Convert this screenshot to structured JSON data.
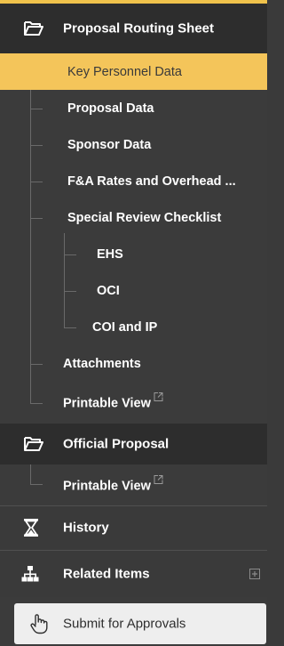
{
  "proposal_routing_sheet": {
    "label": "Proposal Routing Sheet",
    "icon": "folder-open-icon",
    "items": [
      {
        "label": "Key Personnel Data",
        "selected": true
      },
      {
        "label": "Proposal Data"
      },
      {
        "label": "Sponsor Data"
      },
      {
        "label": "F&A Rates and Overhead ..."
      },
      {
        "label": "Special Review Checklist"
      },
      {
        "label": "EHS"
      },
      {
        "label": "OCI"
      },
      {
        "label": "COI and IP"
      },
      {
        "label": "Attachments"
      },
      {
        "label": "Printable View",
        "icon": "external-link-icon"
      }
    ]
  },
  "official_proposal": {
    "label": "Official Proposal",
    "icon": "folder-open-icon",
    "items": [
      {
        "label": "Printable View",
        "icon": "external-link-icon"
      }
    ]
  },
  "history": {
    "label": "History",
    "icon": "hourglass-icon"
  },
  "related_items": {
    "label": "Related Items",
    "icon": "sitemap-icon",
    "expand_icon": "plus-square-icon"
  },
  "submit": {
    "label": "Submit for Approvals",
    "icon": "hand-pointer-icon"
  },
  "colors": {
    "accent": "#f4c55a",
    "sidebar_bg": "#3a3a3a",
    "header_bg": "#2d2d2d"
  }
}
